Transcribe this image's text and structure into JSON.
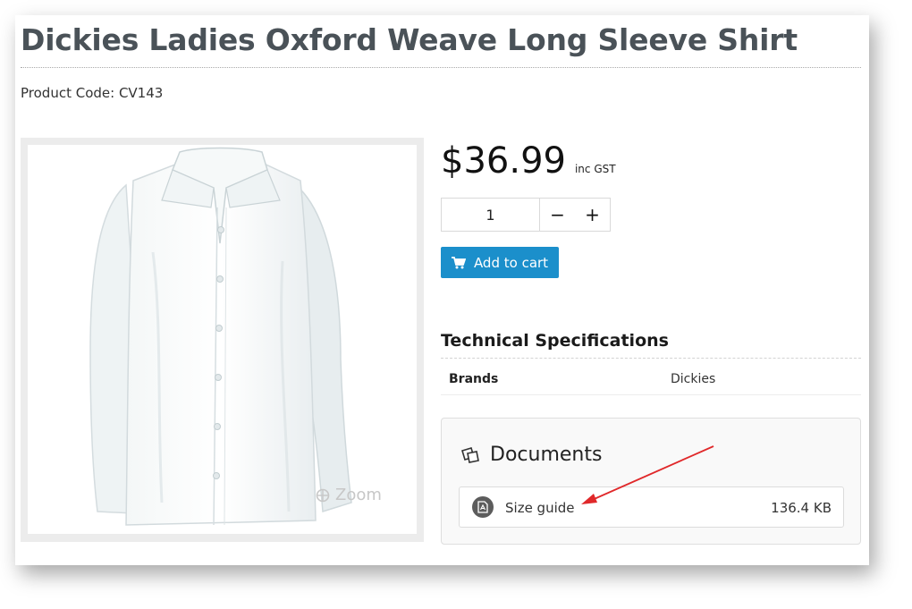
{
  "product": {
    "title": "Dickies Ladies Oxford Weave Long Sleeve Shirt",
    "code_label": "Product Code: CV143",
    "zoom_label": "Zoom"
  },
  "purchase": {
    "price": "$36.99",
    "price_suffix": "inc GST",
    "quantity": "1",
    "decrement": "−",
    "increment": "+",
    "add_to_cart": "Add to cart",
    "accent_color": "#1b8fcb"
  },
  "specs": {
    "title": "Technical Specifications",
    "rows": [
      {
        "key": "Brands",
        "value": "Dickies"
      }
    ]
  },
  "documents": {
    "title": "Documents",
    "items": [
      {
        "name": "Size guide",
        "size": "136.4 KB",
        "icon": "pdf-icon"
      }
    ]
  },
  "annotation": {
    "arrow_color": "#e0282a"
  }
}
